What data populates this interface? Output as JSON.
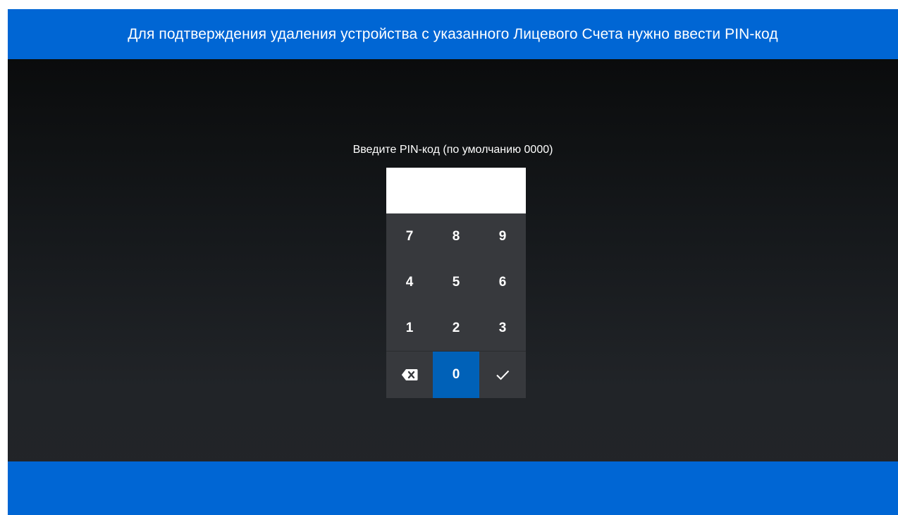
{
  "header": {
    "message": "Для подтверждения удаления устройства с указанного Лицевого Счета нужно ввести PIN-код"
  },
  "pin_dialog": {
    "prompt": "Введите PIN-код (по умолчанию 0000)",
    "entered_value": "",
    "keys": {
      "k7": "7",
      "k8": "8",
      "k9": "9",
      "k4": "4",
      "k5": "5",
      "k6": "6",
      "k1": "1",
      "k2": "2",
      "k3": "3",
      "k0": "0"
    },
    "icons": {
      "backspace": "backspace-icon",
      "confirm": "checkmark-icon"
    },
    "focused_key": "0"
  },
  "colors": {
    "banner": "#0066d4",
    "focused_key": "#0061b8",
    "keypad_bg": "#37393d"
  }
}
